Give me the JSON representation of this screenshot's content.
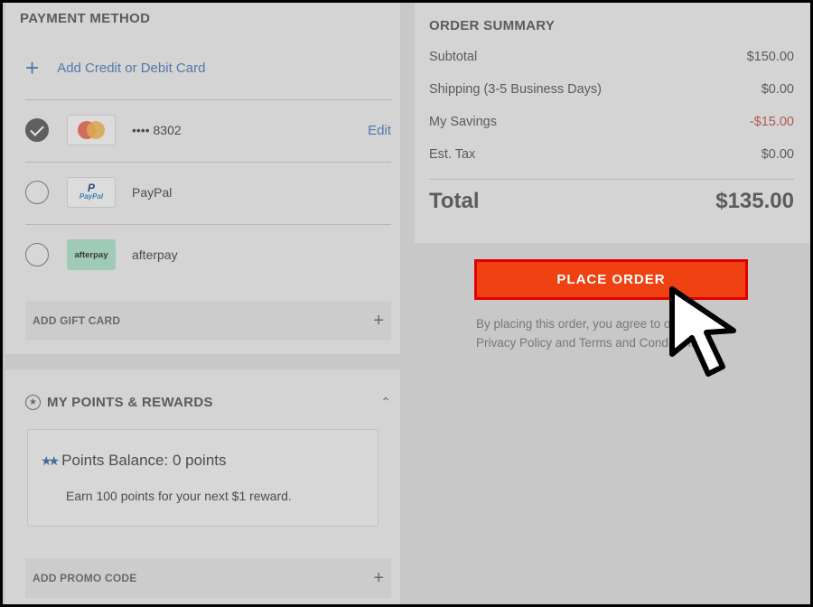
{
  "payment": {
    "title": "PAYMENT METHOD",
    "add_card": "Add Credit or Debit Card",
    "methods": [
      {
        "name": "mastercard",
        "label": "•••• 8302",
        "selected": true,
        "action": "Edit"
      },
      {
        "name": "paypal",
        "label": "PayPal",
        "logo_text": "PayPal",
        "selected": false
      },
      {
        "name": "afterpay",
        "label": "afterpay",
        "logo_text": "afterpay",
        "selected": false
      }
    ],
    "gift_card": "ADD GIFT CARD"
  },
  "rewards": {
    "title": "MY POINTS & REWARDS",
    "balance": "Points Balance: 0 points",
    "earn": "Earn 100 points for your next $1 reward.",
    "promo": "ADD PROMO CODE"
  },
  "summary": {
    "title": "ORDER SUMMARY",
    "subtotal_label": "Subtotal",
    "subtotal": "$150.00",
    "shipping_label": "Shipping (3-5 Business Days)",
    "shipping": "$0.00",
    "savings_label": "My Savings",
    "savings": "-$15.00",
    "tax_label": "Est. Tax",
    "tax": "$0.00",
    "total_label": "Total",
    "total": "$135.00"
  },
  "place_order": "PLACE ORDER",
  "terms_line1": "By placing this order, you agree to our",
  "terms_line2": "Privacy Policy and Terms and Conditions",
  "colors": {
    "accent_red": "#ef4111",
    "link_blue": "#4a78b5",
    "savings_red": "#c05050"
  }
}
